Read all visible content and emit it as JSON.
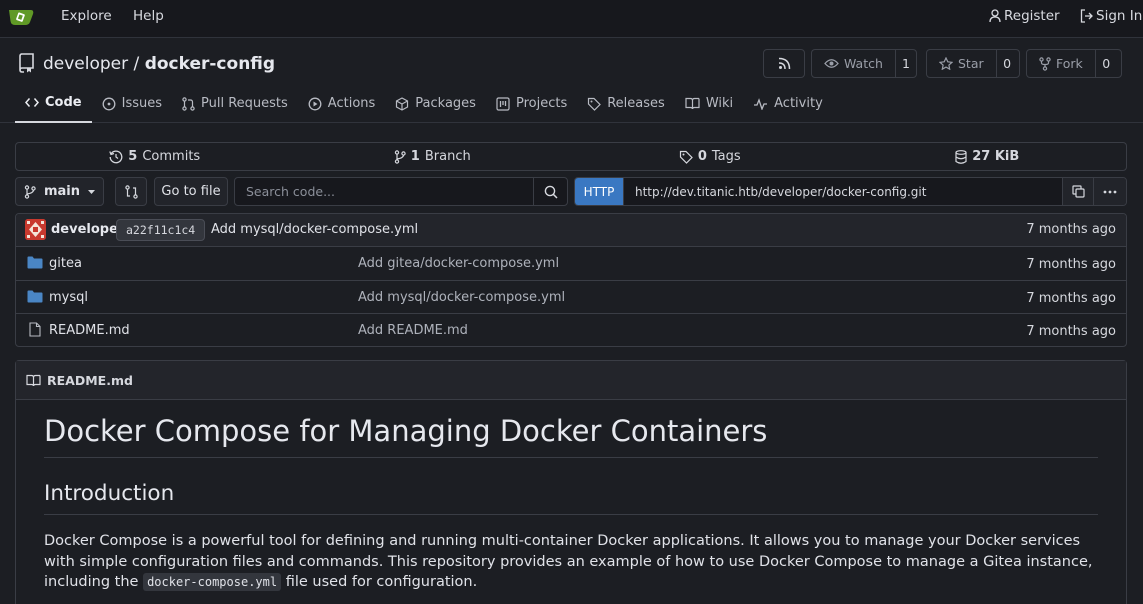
{
  "nav": {
    "links": [
      "Explore",
      "Help"
    ],
    "register": "Register",
    "sign_in": "Sign In",
    "logo_icon": "gitea-teacup-logo"
  },
  "repo": {
    "owner": "developer",
    "separator": "/",
    "name": "docker-config",
    "rss_icon": "rss-icon",
    "watch": {
      "label": "Watch",
      "count": "1"
    },
    "star": {
      "label": "Star",
      "count": "0"
    },
    "fork": {
      "label": "Fork",
      "count": "0"
    }
  },
  "tabs": [
    {
      "label": "Code",
      "icon": "code-icon",
      "active": true
    },
    {
      "label": "Issues",
      "icon": "issue-icon"
    },
    {
      "label": "Pull Requests",
      "icon": "pull-request-icon"
    },
    {
      "label": "Actions",
      "icon": "play-icon"
    },
    {
      "label": "Packages",
      "icon": "package-icon"
    },
    {
      "label": "Projects",
      "icon": "project-icon"
    },
    {
      "label": "Releases",
      "icon": "tag-icon"
    },
    {
      "label": "Wiki",
      "icon": "book-icon"
    },
    {
      "label": "Activity",
      "icon": "pulse-icon"
    }
  ],
  "stats": {
    "commits_count": "5",
    "commits_label": "Commits",
    "branch_count": "1",
    "branch_label": "Branch",
    "tags_count": "0",
    "tags_label": "Tags",
    "size_count": "27 KiB"
  },
  "toolbar": {
    "branch": "main",
    "go_to_file": "Go to file",
    "search_placeholder": "Search code...",
    "clone_protocol": "HTTP",
    "clone_url": "http://dev.titanic.htb/developer/docker-config.git"
  },
  "latest_commit": {
    "author": "developer",
    "sha": "a22f11c1c4",
    "message": "Add mysql/docker-compose.yml",
    "time": "7 months ago"
  },
  "files": [
    {
      "name": "gitea",
      "type": "folder",
      "message": "Add gitea/docker-compose.yml",
      "time": "7 months ago"
    },
    {
      "name": "mysql",
      "type": "folder",
      "message": "Add mysql/docker-compose.yml",
      "time": "7 months ago"
    },
    {
      "name": "README.md",
      "type": "file",
      "message": "Add README.md",
      "time": "7 months ago"
    }
  ],
  "readme": {
    "filename": "README.md",
    "h1": "Docker Compose for Managing Docker Containers",
    "h2": "Introduction",
    "para_before": "Docker Compose is a powerful tool for defining and running multi-container Docker applications. It allows you to manage your Docker services with simple configuration files and commands. This repository provides an example of how to use Docker Compose to manage a Gitea instance, including the ",
    "para_code": "docker-compose.yml",
    "para_after": " file used for configuration."
  },
  "colors": {
    "background": "#1c1e23",
    "header": "#17181d",
    "accent_blue": "#3a78c2",
    "logo_green": "#609926",
    "folder_blue": "#4a86c5"
  }
}
